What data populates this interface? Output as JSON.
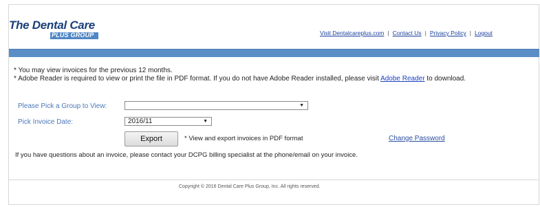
{
  "header": {
    "logo_main": "The Dental Care",
    "logo_sub": "PLUS GROUP",
    "nav": {
      "visit_link": "Visit Dentalcareplus.com",
      "contact_link": "Contact Us",
      "privacy_link": "Privacy Policy",
      "logout_link": "Logout",
      "separator": "|"
    },
    "bar_color": "#5b8dc7"
  },
  "notes": {
    "line1": "* You may view invoices for the previous 12 months.",
    "line2_prefix": "* Adobe Reader is required to view or print the file in PDF format. If you do not have Adobe Reader installed, please visit ",
    "line2_link": "Adobe Reader",
    "line2_suffix": " to download."
  },
  "form": {
    "group_label": "Please Pick a Group to View:",
    "group_value": "",
    "date_label": "Pick Invoice Date:",
    "date_value": "2016/11",
    "dropdown_arrow": "▼",
    "export_button": "Export",
    "export_note": "* View and export invoices in PDF format",
    "change_password_link": "Change Password"
  },
  "help_text": "If you have questions about an invoice, please contact your DCPG billing specialist at the phone/email on your invoice.",
  "footer": {
    "copyright": "Copyright © 2016 Dental Care Plus Group, Inc. All rights reserved."
  }
}
